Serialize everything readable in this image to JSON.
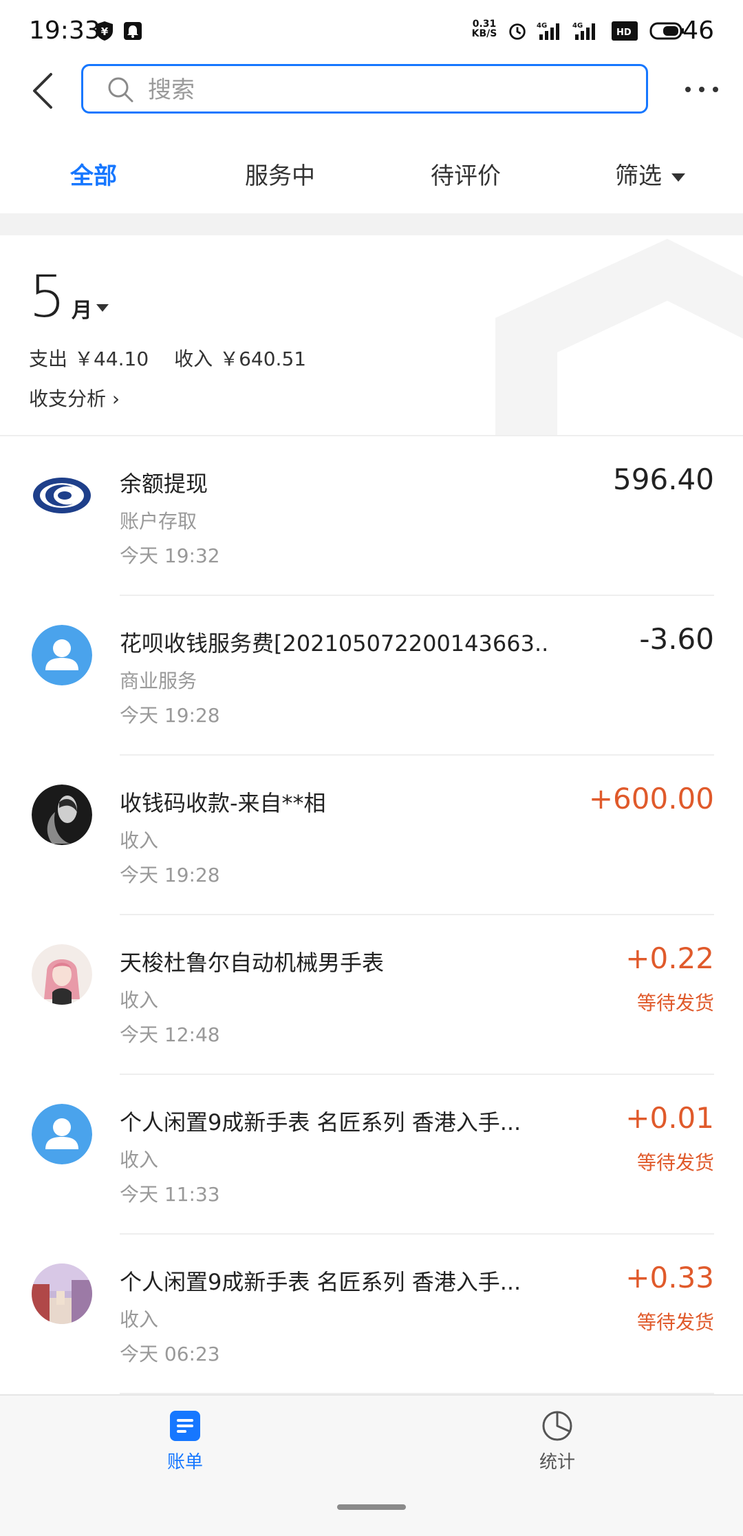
{
  "status_bar": {
    "time": "19:33",
    "net_speed_value": "0.31",
    "net_speed_unit": "KB/S",
    "battery": "46",
    "icons": [
      "yen-shield-icon",
      "notification-bell-icon",
      "alarm-icon",
      "signal-4g-icon",
      "signal-4g-icon",
      "hd-icon",
      "battery-icon"
    ]
  },
  "header": {
    "search_placeholder": "搜索",
    "back_icon": "chevron-left-icon",
    "more_icon": "more-dots-icon"
  },
  "tabs": [
    {
      "label": "全部",
      "active": true
    },
    {
      "label": "服务中",
      "active": false
    },
    {
      "label": "待评价",
      "active": false
    },
    {
      "label": "筛选",
      "active": false
    }
  ],
  "summary": {
    "month": "5",
    "month_unit": "月",
    "expense_label": "支出",
    "expense_value": "￥44.10",
    "income_label": "收入",
    "income_value": "￥640.51",
    "analysis_link": "收支分析 ›"
  },
  "transactions": [
    {
      "title": "余额提现",
      "category": "账户存取",
      "date": "今天",
      "time": "19:32",
      "amount": "596.40",
      "status": "",
      "avatar": "unionpay-logo"
    },
    {
      "title": "花呗收钱服务费[202105072200143663...",
      "category": "商业服务",
      "date": "今天",
      "time": "19:28",
      "amount": "-3.60",
      "status": "",
      "avatar": "default-user-avatar"
    },
    {
      "title": "收钱码收款-来自**相",
      "category": "收入",
      "date": "今天",
      "time": "19:28",
      "amount": "+600.00",
      "status": "",
      "avatar": "photo-avatar-dark"
    },
    {
      "title": "天梭杜鲁尔自动机械男手表",
      "category": "收入",
      "date": "今天",
      "time": "12:48",
      "amount": "+0.22",
      "status": "等待发货",
      "avatar": "photo-avatar-pink"
    },
    {
      "title": "个人闲置9成新手表 名匠系列 香港入手...",
      "category": "收入",
      "date": "今天",
      "time": "11:33",
      "amount": "+0.01",
      "status": "等待发货",
      "avatar": "default-user-avatar"
    },
    {
      "title": "个人闲置9成新手表 名匠系列 香港入手...",
      "category": "收入",
      "date": "今天",
      "time": "06:23",
      "amount": "+0.33",
      "status": "等待发货",
      "avatar": "photo-avatar-street"
    }
  ],
  "bottom_nav": [
    {
      "label": "账单",
      "icon": "bill-icon",
      "active": true
    },
    {
      "label": "统计",
      "icon": "pie-chart-icon",
      "active": false
    }
  ],
  "colors": {
    "accent": "#1677ff",
    "income": "#e05a2b",
    "text": "#222222",
    "muted": "#999999"
  }
}
